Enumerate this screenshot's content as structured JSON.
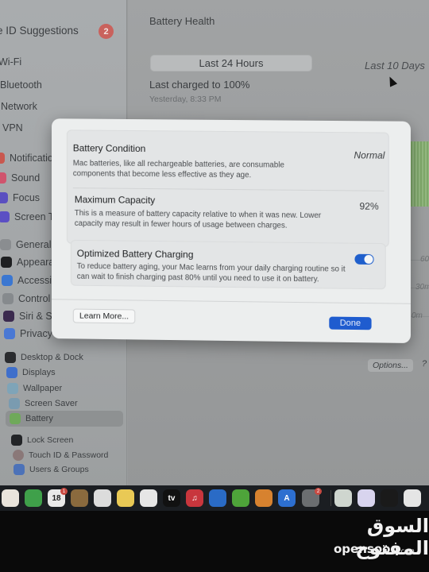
{
  "sidebar": {
    "apple_id_suggestions": {
      "label": "e ID Suggestions",
      "badge": "2"
    },
    "items": [
      {
        "label": "Wi-Fi",
        "icon": "wifi-icon"
      },
      {
        "label": "Bluetooth",
        "icon": "bluetooth-icon"
      },
      {
        "label": "Network",
        "icon": "network-icon"
      },
      {
        "label": "VPN",
        "icon": "vpn-icon"
      },
      {
        "label": "Notification",
        "icon": "bell-icon"
      },
      {
        "label": "Sound",
        "icon": "speaker-icon"
      },
      {
        "label": "Focus",
        "icon": "moon-icon"
      },
      {
        "label": "Screen Tim",
        "icon": "hourglass-icon"
      },
      {
        "label": "General",
        "icon": "gear-icon"
      },
      {
        "label": "Appearanc",
        "icon": "appearance-icon"
      },
      {
        "label": "Accessibilit",
        "icon": "accessibility-icon"
      },
      {
        "label": "Control Ce",
        "icon": "control-center-icon"
      },
      {
        "label": "Siri & Spotl",
        "icon": "siri-icon"
      },
      {
        "label": "Privacy & S",
        "icon": "hand-icon"
      },
      {
        "label": "Desktop & Dock",
        "icon": "dock-icon"
      },
      {
        "label": "Displays",
        "icon": "sun-icon"
      },
      {
        "label": "Wallpaper",
        "icon": "flower-icon"
      },
      {
        "label": "Screen Saver",
        "icon": "screen-saver-icon"
      },
      {
        "label": "Battery",
        "icon": "battery-icon",
        "selected": true
      },
      {
        "label": "Lock Screen",
        "icon": "lock-icon"
      },
      {
        "label": "Touch ID & Password",
        "icon": "fingerprint-icon"
      },
      {
        "label": "Users & Groups",
        "icon": "users-icon"
      }
    ]
  },
  "main": {
    "title": "Battery Health",
    "tabs": [
      {
        "label": "Last 24 Hours",
        "selected": true
      },
      {
        "label": "Last 10 Days",
        "selected": false
      }
    ],
    "last_charged": "Last charged to 100%",
    "last_charged_time": "Yesterday, 8:33 PM",
    "chart_axis": [
      "60",
      "30m",
      "0m"
    ],
    "options_label": "Options...",
    "help_label": "?"
  },
  "dialog": {
    "battery_condition": {
      "title": "Battery Condition",
      "description": "Mac batteries, like all rechargeable batteries, are consumable components that become less effective as they age.",
      "value": "Normal"
    },
    "maximum_capacity": {
      "title": "Maximum Capacity",
      "description": "This is a measure of battery capacity relative to when it was new. Lower capacity may result in fewer hours of usage between charges.",
      "value": "92%"
    },
    "optimized_charging": {
      "title": "Optimized Battery Charging",
      "description": "To reduce battery aging, your Mac learns from your daily charging routine so it can wait to finish charging past 80% until you need to use it on battery.",
      "enabled": true
    },
    "learn_more_label": "Learn More...",
    "done_label": "Done"
  },
  "dock": {
    "apps": [
      {
        "name": "Photos",
        "icon": "photos-icon",
        "color": "#e9e4dc"
      },
      {
        "name": "FaceTime",
        "icon": "facetime-icon",
        "color": "#3fa04a"
      },
      {
        "name": "Calendar",
        "icon": "calendar-icon",
        "color": "#e9e9e9",
        "text": "18",
        "badge": "1"
      },
      {
        "name": "Contacts",
        "icon": "contacts-icon",
        "color": "#8a6a3e"
      },
      {
        "name": "Reminders",
        "icon": "reminders-icon",
        "color": "#dcdcdc"
      },
      {
        "name": "Notes",
        "icon": "notes-icon",
        "color": "#e9c955"
      },
      {
        "name": "Freeform",
        "icon": "freeform-icon",
        "color": "#e6e6e6"
      },
      {
        "name": "TV",
        "icon": "tv-icon",
        "color": "#111111",
        "text": "tv"
      },
      {
        "name": "Music",
        "icon": "music-icon",
        "color": "#c8363d",
        "text": "♫"
      },
      {
        "name": "Keynote",
        "icon": "keynote-icon",
        "color": "#2a6bc6"
      },
      {
        "name": "Numbers",
        "icon": "numbers-icon",
        "color": "#4ea43a"
      },
      {
        "name": "Pages",
        "icon": "pages-icon",
        "color": "#d7822f"
      },
      {
        "name": "App Store",
        "icon": "app-store-icon",
        "color": "#2d6fd0",
        "text": "A"
      },
      {
        "name": "System Settings",
        "icon": "settings-icon",
        "color": "#6b6e71",
        "badge": "2"
      },
      {
        "name": "Excel",
        "icon": "excel-icon",
        "color": "#cfd6cf"
      },
      {
        "name": "Messenger",
        "icon": "messenger-icon",
        "color": "#d8d4ee"
      },
      {
        "name": "Stocks",
        "icon": "stocks-icon",
        "color": "#1a1a1a"
      },
      {
        "name": "Slack",
        "icon": "slack-icon",
        "color": "#e5e5e5"
      }
    ]
  },
  "watermark": {
    "arabic": "السوق المفتوح",
    "latin": "opensooq",
    "domain": ".com"
  },
  "colors": {
    "accent": "#1f5ccf",
    "badge": "#c9625d",
    "chart_green": "#7ea86a"
  }
}
